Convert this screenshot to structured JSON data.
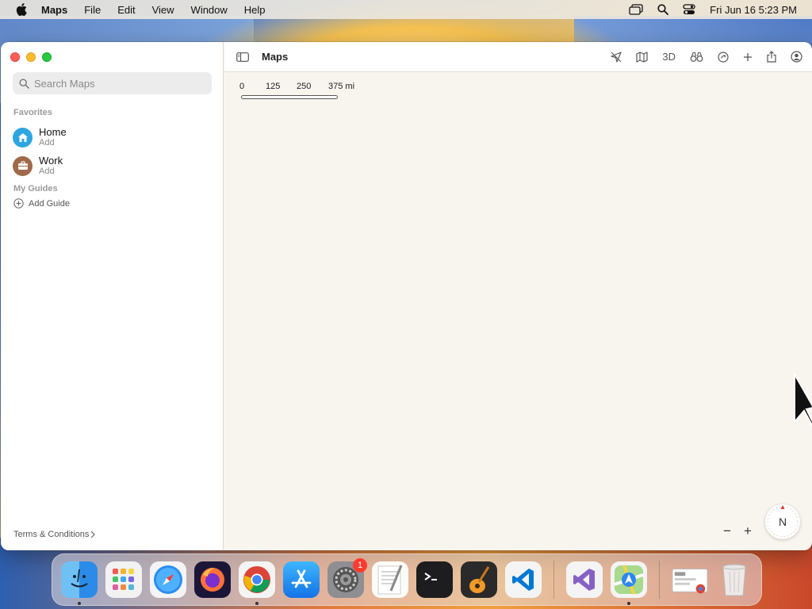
{
  "menubar": {
    "app_name": "Maps",
    "items": [
      "File",
      "Edit",
      "View",
      "Window",
      "Help"
    ],
    "clock": "Fri Jun 16  5:23 PM",
    "icons": [
      "screen-mirroring-icon",
      "spotlight-search-icon",
      "control-center-icon"
    ]
  },
  "sidebar": {
    "search_placeholder": "Search Maps",
    "favorites_label": "Favorites",
    "favorites": [
      {
        "title": "Home",
        "subtitle": "Add",
        "icon": "house-icon",
        "color": "#2ca5e0"
      },
      {
        "title": "Work",
        "subtitle": "Add",
        "icon": "briefcase-icon",
        "color": "#a0694a"
      }
    ],
    "guides_label": "My Guides",
    "add_guide_label": "Add Guide",
    "terms_label": "Terms & Conditions"
  },
  "toolbar": {
    "title": "Maps",
    "three_d_label": "3D",
    "icons": [
      "location-arrow-icon",
      "map-icon",
      "3d-toggle",
      "look-around-icon",
      "traffic-icon",
      "add-icon",
      "share-icon",
      "account-icon"
    ]
  },
  "map": {
    "scale_labels": [
      "0",
      "125",
      "250",
      "375 mi"
    ],
    "zoom_out": "−",
    "zoom_in": "+",
    "compass_label": "N"
  },
  "dock": {
    "apps": [
      "Finder",
      "Launchpad",
      "Safari",
      "Firefox",
      "Chrome",
      "App Store",
      "System Settings",
      "TextEdit",
      "Terminal",
      "GarageBand",
      "Visual Studio Code",
      "Visual Studio",
      "Maps",
      "Preview",
      "Trash"
    ],
    "settings_badge": "1"
  },
  "colors": {
    "accent": "#007aff",
    "map_background": "#f8f4ee"
  }
}
